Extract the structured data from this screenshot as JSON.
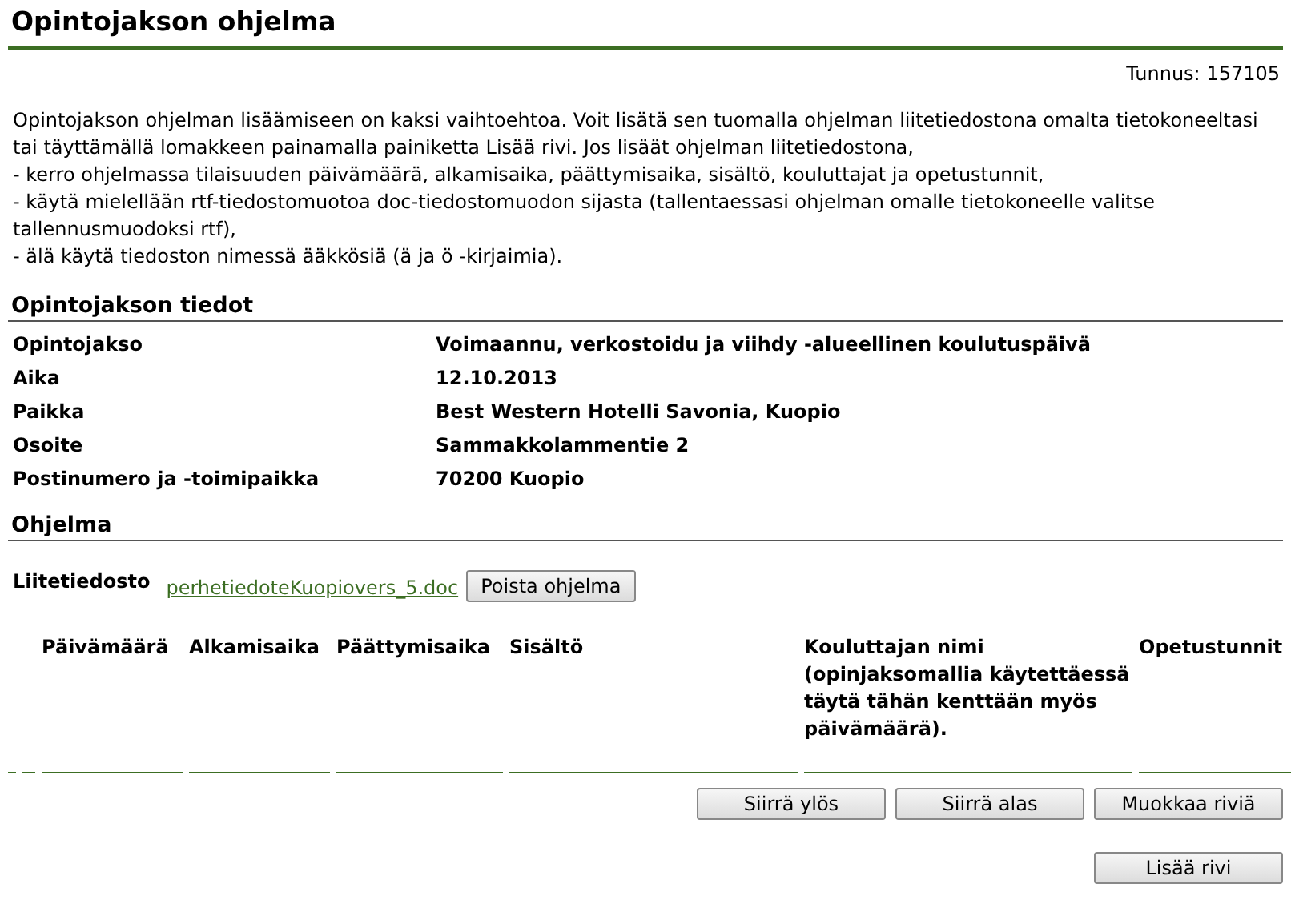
{
  "page_title": "Opintojakson ohjelma",
  "id_label": "Tunnus:",
  "id_value": "157105",
  "intro": [
    "Opintojakson ohjelman lisäämiseen on kaksi vaihtoehtoa. Voit lisätä sen tuomalla ohjelman liitetiedostona omalta tietokoneeltasi tai täyttämällä lomakkeen painamalla painiketta Lisää rivi. Jos lisäät ohjelman liitetiedostona,",
    "- kerro ohjelmassa tilaisuuden päivämäärä, alkamisaika, päättymisaika, sisältö, kouluttajat ja opetustunnit,",
    "- käytä mielellään rtf-tiedostomuotoa doc-tiedostomuodon sijasta (tallentaessasi ohjelman omalle tietokoneelle valitse tallennusmuodoksi rtf),",
    "- älä käytä tiedoston nimessä ääkkösiä (ä ja ö -kirjaimia)."
  ],
  "details": {
    "heading": "Opintojakson tiedot",
    "fields": [
      {
        "label": "Opintojakso",
        "value": "Voimaannu, verkostoidu ja viihdy -alueellinen koulutuspäivä"
      },
      {
        "label": "Aika",
        "value": "12.10.2013"
      },
      {
        "label": "Paikka",
        "value": "Best Western Hotelli Savonia, Kuopio"
      },
      {
        "label": "Osoite",
        "value": "Sammakkolammentie 2"
      },
      {
        "label": "Postinumero ja -toimipaikka",
        "value": "70200 Kuopio"
      }
    ]
  },
  "program": {
    "heading": "Ohjelma",
    "attachment_label": "Liitetiedosto",
    "attachment_link": "perhetiedoteKuopiovers_5.doc",
    "remove_button": "Poista ohjelma",
    "columns": [
      "",
      "",
      "Päivämäärä",
      "Alkamisaika",
      "Päättymisaika",
      "Sisältö",
      "Kouluttajan nimi (opinjaksomallia käytettäessä täytä tähän kenttään myös päivämäärä).",
      "Opetustunnit"
    ],
    "row_buttons": [
      "Siirrä ylös",
      "Siirrä alas",
      "Muokkaa riviä"
    ],
    "add_button": "Lisää rivi"
  }
}
